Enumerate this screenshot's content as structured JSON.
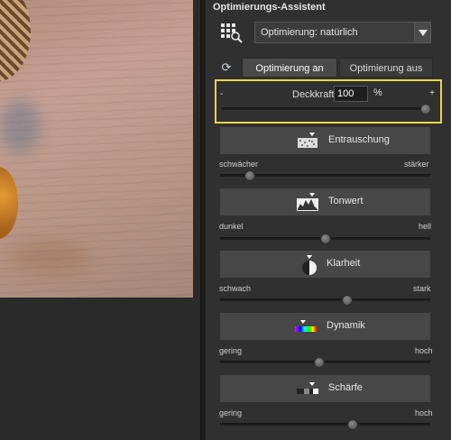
{
  "panel": {
    "title": "Optimierungs-Assistent",
    "mode_select": {
      "value": "Optimierung: natürlich"
    },
    "toggle": {
      "on_label": "Optimierung an",
      "off_label": "Optimierung aus"
    },
    "opacity": {
      "minus": "-",
      "plus": "+",
      "label": "Deckkraft",
      "value": "100",
      "unit": "%",
      "level_percent": 100
    },
    "sections": [
      {
        "label": "Entrauschung",
        "icon": "noise-icon",
        "left_label": "schwächer",
        "right_label": "stärker",
        "level_percent": 12
      },
      {
        "label": "Tonwert",
        "icon": "histogram-icon",
        "left_label": "dunkel",
        "right_label": "hell",
        "level_percent": 50
      },
      {
        "label": "Klarheit",
        "icon": "clarity-icon",
        "left_label": "schwach",
        "right_label": "stark",
        "level_percent": 61
      },
      {
        "label": "Dynamik",
        "icon": "color-dynamics-icon",
        "left_label": "gering",
        "right_label": "hoch",
        "level_percent": 47
      },
      {
        "label": "Schärfe",
        "icon": "sharpness-icon",
        "left_label": "gering",
        "right_label": "hoch",
        "level_percent": 64
      }
    ]
  },
  "colors": {
    "highlight": "#e8d44a",
    "panel_bg": "#303030",
    "button_bg": "#474747"
  }
}
